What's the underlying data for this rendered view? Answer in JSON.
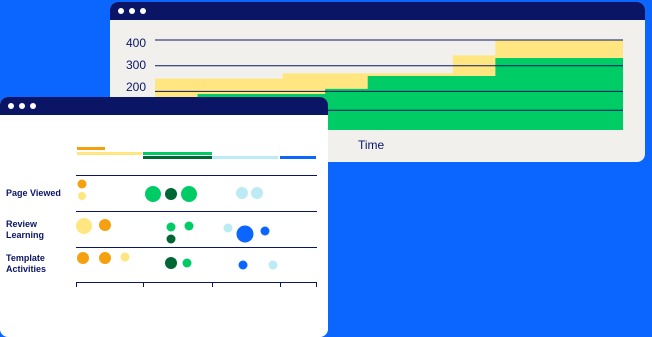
{
  "colors": {
    "background": "#0a66ff",
    "titlebar": "#0b1566",
    "yellow": "#ffe680",
    "green": "#00cc66",
    "dark_green": "#006633",
    "orange": "#f5a00f",
    "light_blue": "#bdebf5",
    "blue": "#0a66ff"
  },
  "back_window": {
    "y_ticks": [
      "400",
      "300",
      "200"
    ],
    "x_label": "Time"
  },
  "chart_data": [
    {
      "type": "area",
      "title": "",
      "xlabel": "Time",
      "ylabel": "",
      "ylim": [
        0,
        450
      ],
      "y_ticks": [
        400,
        300,
        200
      ],
      "x": [
        0,
        1,
        2,
        3,
        4,
        5,
        6,
        7,
        8,
        9,
        10
      ],
      "series": [
        {
          "color": "#ffe680",
          "values": [
            250,
            250,
            250,
            270,
            270,
            270,
            270,
            340,
            400,
            400,
            400
          ]
        },
        {
          "color": "#00cc66",
          "values": [
            0,
            190,
            190,
            190,
            210,
            260,
            260,
            260,
            330,
            330,
            330
          ]
        }
      ]
    },
    {
      "type": "scatter",
      "rows": [
        "Page Viewed",
        "Review Learning",
        "Template Activities"
      ],
      "column_groups": 4
    }
  ],
  "front_window": {
    "rows": [
      {
        "label_lines": [
          "Page Viewed"
        ]
      },
      {
        "label_lines": [
          "Review",
          "Learning"
        ]
      },
      {
        "label_lines": [
          "Template",
          "Activities"
        ]
      }
    ]
  }
}
